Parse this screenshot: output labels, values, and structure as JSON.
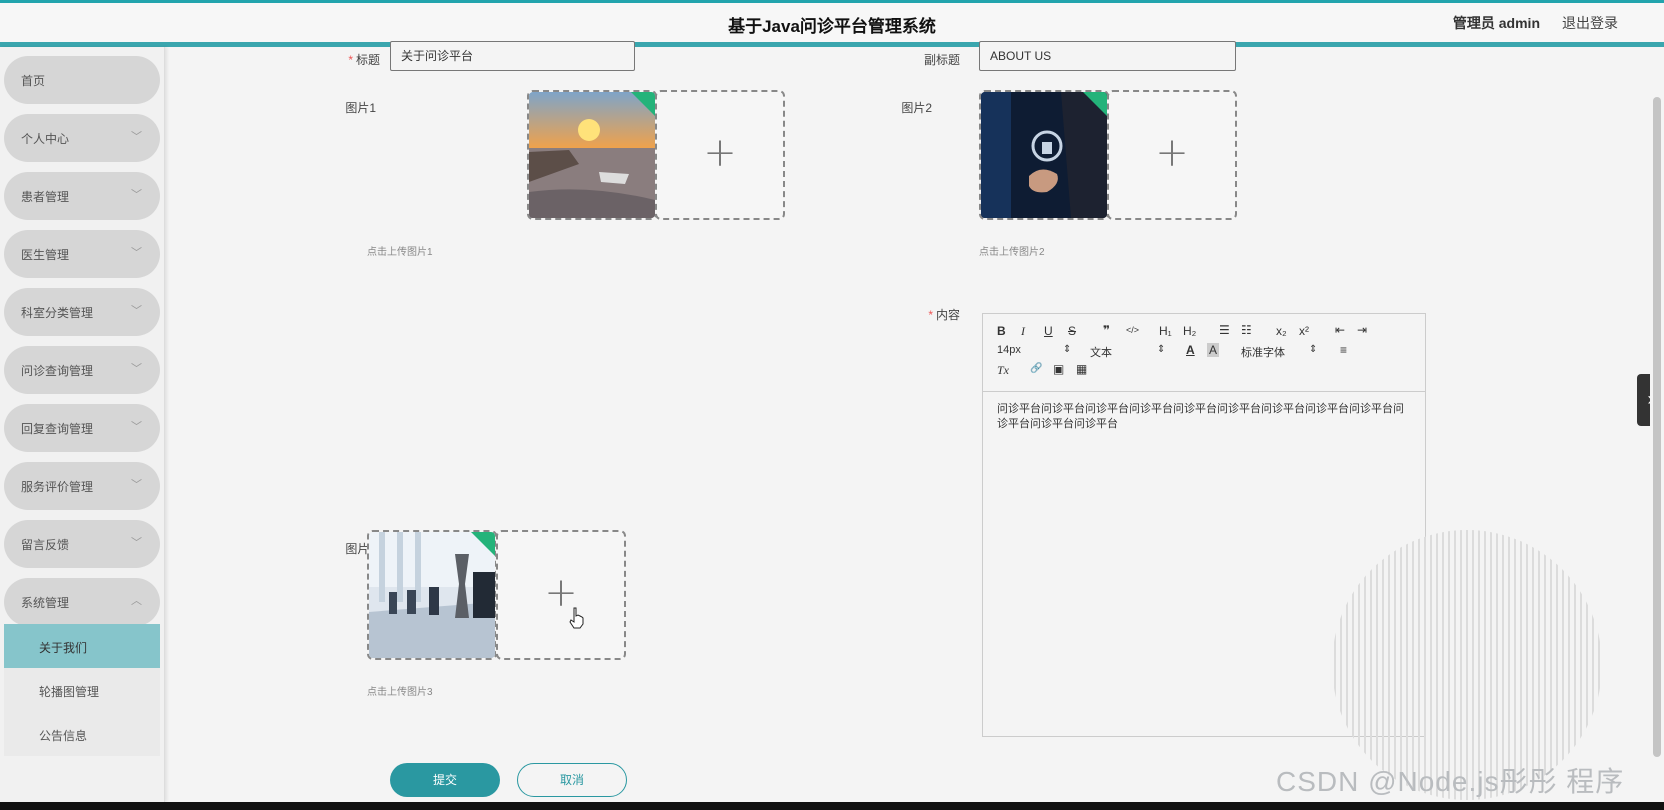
{
  "header": {
    "title": "基于Java问诊平台管理系统",
    "admin_label": "管理员 admin",
    "logout_label": "退出登录"
  },
  "sidebar": {
    "items": [
      {
        "label": "首页",
        "expandable": false
      },
      {
        "label": "个人中心",
        "expandable": true
      },
      {
        "label": "患者管理",
        "expandable": true
      },
      {
        "label": "医生管理",
        "expandable": true
      },
      {
        "label": "科室分类管理",
        "expandable": true
      },
      {
        "label": "问诊查询管理",
        "expandable": true
      },
      {
        "label": "回复查询管理",
        "expandable": true
      },
      {
        "label": "服务评价管理",
        "expandable": true
      },
      {
        "label": "留言反馈",
        "expandable": true
      },
      {
        "label": "系统管理",
        "expandable": true,
        "expanded": true
      }
    ],
    "sub_items": [
      {
        "label": "关于我们",
        "active": true
      },
      {
        "label": "轮播图管理",
        "active": false
      },
      {
        "label": "公告信息",
        "active": false
      }
    ],
    "chevron_down": "﹀",
    "chevron_up": "︿"
  },
  "form": {
    "title_label": "标题",
    "title_value": "关于问诊平台",
    "subtitle_label": "副标题",
    "subtitle_value": "ABOUT US",
    "image1_label": "图片1",
    "image1_hint": "点击上传图片1",
    "image2_label": "图片2",
    "image2_hint": "点击上传图片2",
    "image3_label": "图片3",
    "image3_hint": "点击上传图片3",
    "content_label": "内容",
    "required_mark": "*",
    "plus_symbol": "+"
  },
  "editor": {
    "toolbar": {
      "bold": "B",
      "italic": "I",
      "underline": "U",
      "strike": "S",
      "blockquote": "❞",
      "code": "</>",
      "h1": "H₁",
      "h2": "H₂",
      "ordered_list": "☰",
      "bullet_list": "☷",
      "subscript": "x₂",
      "superscript": "x²",
      "outdent": "⇤",
      "indent": "⇥",
      "font_size": "14px",
      "header_select": "文本",
      "font_color": "A",
      "background_color": "A",
      "font_family": "标准字体",
      "align": "≡",
      "clean": "Tx",
      "link": "🔗",
      "image": "▣",
      "video": "▦",
      "select_arrow": "⇕"
    },
    "content": "问诊平台问诊平台问诊平台问诊平台问诊平台问诊平台问诊平台问诊平台问诊平台问诊平台问诊平台问诊平台"
  },
  "buttons": {
    "submit": "提交",
    "cancel": "取消"
  },
  "side_tab": "›",
  "watermark": "CSDN @Node.js彤彤 程序",
  "colors": {
    "accent": "#2a98a1",
    "active_menu": "#86c5cb",
    "header_border": "#3aa6ae",
    "upload_badge": "#24b37a",
    "required": "#e55555"
  }
}
